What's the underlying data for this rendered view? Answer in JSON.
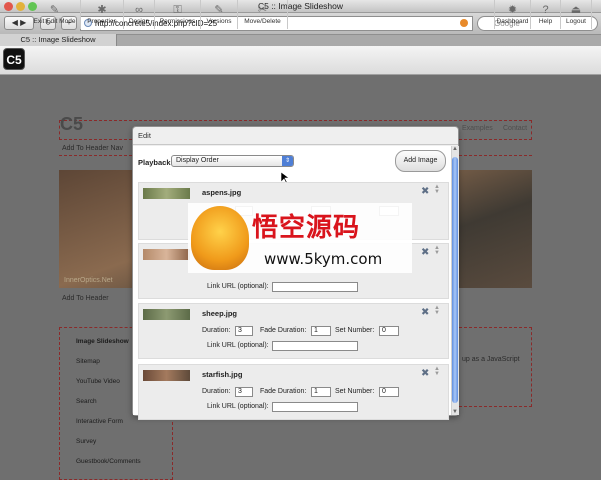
{
  "window": {
    "title": "C5 :: Image Slideshow",
    "tab_label": "C5 :: Image Slideshow"
  },
  "navbar": {
    "back_icon": "back-arrow-icon",
    "forward_icon": "forward-arrow-icon",
    "reload_icon": "reload-icon",
    "add_icon": "plus-icon",
    "url": "http://concrete5/index.php?cID=25",
    "search_placeholder": "Google"
  },
  "toolbar": {
    "logo": "C5",
    "left_items": [
      {
        "label": "Exit Edit Mode",
        "icon": "pencil-icon"
      },
      {
        "label": "Properties",
        "icon": "gear-icon"
      },
      {
        "label": "Design",
        "icon": "glasses-icon"
      },
      {
        "label": "Permissions",
        "icon": "key-icon"
      },
      {
        "label": "Versions",
        "icon": "pencil-icon"
      },
      {
        "label": "Move/Delete",
        "icon": "scissors-icon"
      }
    ],
    "right_items": [
      {
        "label": "Dashboard",
        "icon": "dashboard-gear-icon"
      },
      {
        "label": "Help",
        "icon": "help-icon"
      },
      {
        "label": "Logout",
        "icon": "logout-icon"
      }
    ]
  },
  "page": {
    "site_title": "C5",
    "nav_links": [
      "Examples",
      "Contact"
    ],
    "add_to_header_nav": "Add To Header Nav",
    "add_to_header": "Add To Header",
    "hero_caption": "InnerOptics.Net",
    "sidebar_items": [
      "Image Slideshow",
      "Sitemap",
      "YouTube Video",
      "Search",
      "Interactive Form",
      "Survey",
      "Guestbook/Comments"
    ],
    "right_text": "up as a JavaScript"
  },
  "dialog": {
    "title": "Edit",
    "playback_label": "Playback",
    "playback_value": "Display Order",
    "add_image_label": "Add Image",
    "images": [
      {
        "name": "aspens.jpg",
        "duration": "",
        "fade": "",
        "set": "",
        "link": "",
        "thumb": "#7d8a5a"
      },
      {
        "name": "",
        "duration": "",
        "fade": "",
        "set": "",
        "link": "",
        "thumb": "#9c6c4a"
      },
      {
        "name": "sheep.jpg",
        "duration": "3",
        "fade": "1",
        "set": "0",
        "link": "",
        "thumb": "#6e7c5a"
      },
      {
        "name": "starfish.jpg",
        "duration": "3",
        "fade": "1",
        "set": "0",
        "link": "",
        "thumb": "#7a5a46"
      }
    ],
    "labels": {
      "duration": "Duration:",
      "fade": "Fade Duration:",
      "set": "Set Number:",
      "link": "Link URL (optional):"
    }
  },
  "watermark": {
    "chinese": "悟空源码",
    "url": "www.5kym.com"
  },
  "colors": {
    "accent_blue": "#4f7fd6",
    "page_bg": "#6f6f6f",
    "delete_blue": "#5e6f86"
  }
}
